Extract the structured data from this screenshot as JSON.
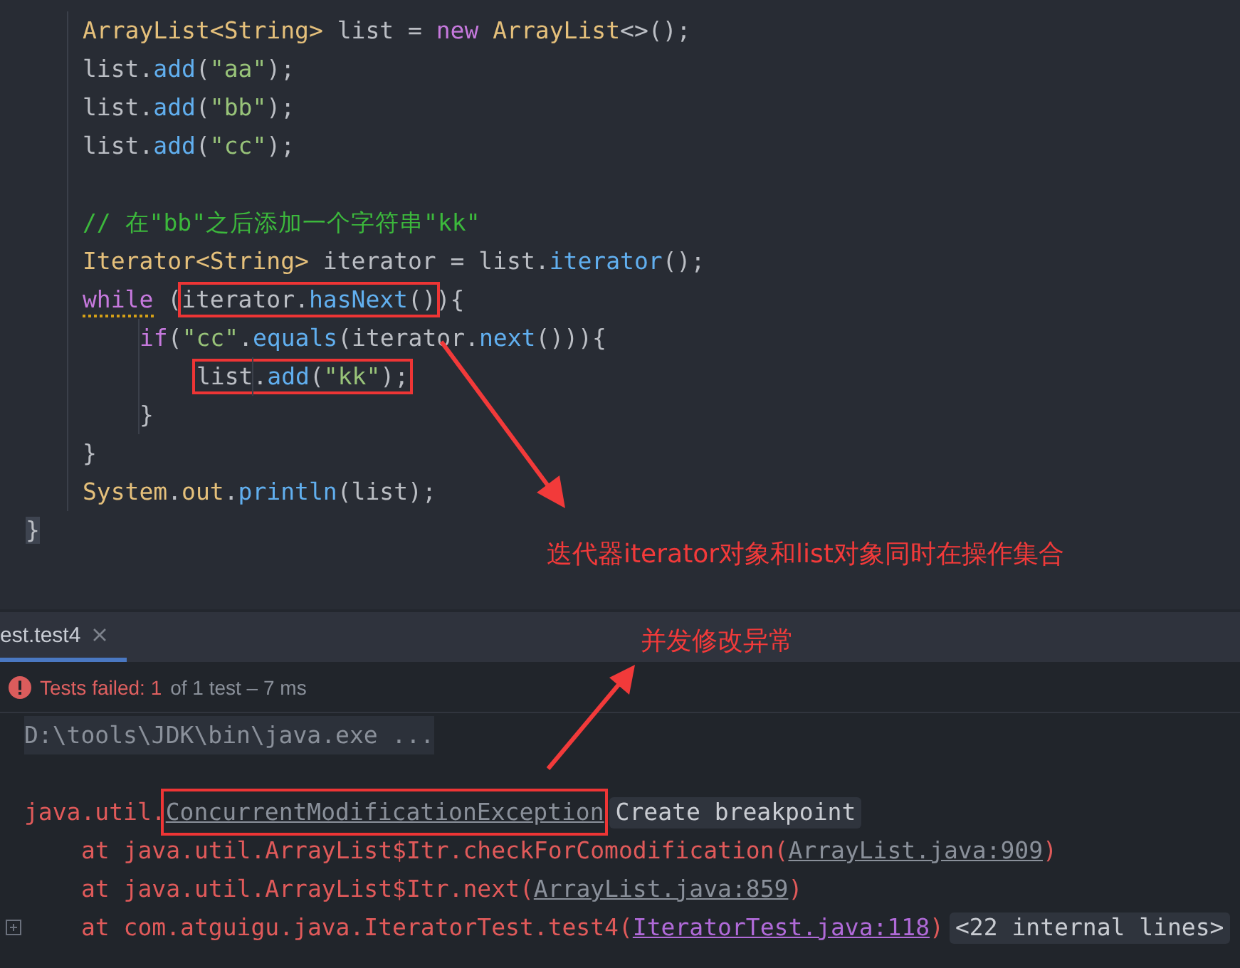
{
  "editor": {
    "lines": [
      {
        "kind": "block",
        "children": [
          {
            "kind": "code",
            "tokens": [
              {
                "kind": "type",
                "text": "ArrayList<String>"
              },
              {
                "kind": "plain",
                "text": " list = "
              },
              {
                "kind": "keyword",
                "text": "new"
              },
              {
                "kind": "type",
                "text": " ArrayList"
              },
              {
                "kind": "plain",
                "text": "<>();"
              }
            ]
          },
          {
            "kind": "code",
            "tokens": [
              {
                "kind": "plain",
                "text": "list."
              },
              {
                "kind": "method",
                "text": "add"
              },
              {
                "kind": "plain",
                "text": "("
              },
              {
                "kind": "string",
                "text": "\"aa\""
              },
              {
                "kind": "plain",
                "text": ");"
              }
            ]
          },
          {
            "kind": "code",
            "tokens": [
              {
                "kind": "plain",
                "text": "list."
              },
              {
                "kind": "method",
                "text": "add"
              },
              {
                "kind": "plain",
                "text": "("
              },
              {
                "kind": "string",
                "text": "\"bb\""
              },
              {
                "kind": "plain",
                "text": ");"
              }
            ]
          },
          {
            "kind": "code",
            "tokens": [
              {
                "kind": "plain",
                "text": "list."
              },
              {
                "kind": "method",
                "text": "add"
              },
              {
                "kind": "plain",
                "text": "("
              },
              {
                "kind": "string",
                "text": "\"cc\""
              },
              {
                "kind": "plain",
                "text": ");"
              }
            ]
          },
          {
            "kind": "blank"
          },
          {
            "kind": "code",
            "tokens": [
              {
                "kind": "comment",
                "text": "// 在\"bb\"之后添加一个字符串\"kk\""
              }
            ]
          },
          {
            "kind": "code",
            "tokens": [
              {
                "kind": "type",
                "text": "Iterator<String>"
              },
              {
                "kind": "plain",
                "text": " iterator = list."
              },
              {
                "kind": "method",
                "text": "iterator"
              },
              {
                "kind": "plain",
                "text": "();"
              }
            ]
          },
          {
            "kind": "code",
            "tokens": [
              {
                "kind": "keyword",
                "text": "while",
                "warning": true
              },
              {
                "kind": "plain",
                "text": " ("
              },
              {
                "kind": "group",
                "boxed": true,
                "tokens": [
                  {
                    "kind": "plain",
                    "text": "iterator."
                  },
                  {
                    "kind": "method",
                    "text": "hasNext"
                  },
                  {
                    "kind": "plain",
                    "text": "()"
                  }
                ]
              },
              {
                "kind": "plain",
                "text": "){"
              }
            ],
            "children": [
              {
                "kind": "code",
                "tokens": [
                  {
                    "kind": "keyword",
                    "text": "if"
                  },
                  {
                    "kind": "plain",
                    "text": "("
                  },
                  {
                    "kind": "string",
                    "text": "\"cc\""
                  },
                  {
                    "kind": "plain",
                    "text": "."
                  },
                  {
                    "kind": "method",
                    "text": "equals"
                  },
                  {
                    "kind": "plain",
                    "text": "(iterator."
                  },
                  {
                    "kind": "method",
                    "text": "next"
                  },
                  {
                    "kind": "plain",
                    "text": "())){"
                  }
                ],
                "children": [
                  {
                    "kind": "code",
                    "tokens": [
                      {
                        "kind": "group",
                        "boxed": true,
                        "tokens": [
                          {
                            "kind": "plain",
                            "text": "list."
                          },
                          {
                            "kind": "method",
                            "text": "add"
                          },
                          {
                            "kind": "plain",
                            "text": "("
                          },
                          {
                            "kind": "string",
                            "text": "\"kk\""
                          },
                          {
                            "kind": "plain",
                            "text": ");"
                          }
                        ]
                      }
                    ]
                  }
                ]
              },
              {
                "kind": "code",
                "tokens": [
                  {
                    "kind": "plain",
                    "text": "}"
                  }
                ]
              }
            ]
          },
          {
            "kind": "code",
            "tokens": [
              {
                "kind": "plain",
                "text": "}"
              }
            ]
          },
          {
            "kind": "code",
            "tokens": [
              {
                "kind": "type",
                "text": "System"
              },
              {
                "kind": "plain",
                "text": "."
              },
              {
                "kind": "field",
                "text": "out"
              },
              {
                "kind": "plain",
                "text": "."
              },
              {
                "kind": "method",
                "text": "println"
              },
              {
                "kind": "plain",
                "text": "(list);"
              }
            ]
          }
        ]
      },
      {
        "kind": "code",
        "tokens": [
          {
            "kind": "plain",
            "text": "}",
            "matched": true
          }
        ]
      }
    ]
  },
  "annotations": [
    {
      "text": "迭代器iterator对象和list对象同时在操作集合"
    },
    {
      "text": "并发修改异常"
    }
  ],
  "run_panel": {
    "tabs": [
      {
        "label": "est.test4",
        "selected": true
      }
    ],
    "status": {
      "kind": "failed",
      "summary": "Tests failed: 1",
      "detail": "of 1 test – 7 ms"
    },
    "console": [
      {
        "kind": "command",
        "segments": [
          {
            "kind": "command",
            "text": "D:\\tools\\JDK\\bin\\java.exe ..."
          }
        ]
      },
      {
        "kind": "blank"
      },
      {
        "kind": "trace",
        "segments": [
          {
            "kind": "error",
            "text": "java.util."
          },
          {
            "kind": "link",
            "text": "ConcurrentModificationException",
            "boxed": true,
            "visited": false
          },
          {
            "kind": "chip",
            "text": "Create breakpoint"
          }
        ],
        "children": [
          {
            "kind": "trace",
            "expandable": false,
            "segments": [
              {
                "kind": "error",
                "text": "at java.util.ArrayList$Itr.checkForComodification("
              },
              {
                "kind": "link",
                "text": "ArrayList.java:909",
                "visited": false
              },
              {
                "kind": "error",
                "text": ")"
              }
            ]
          },
          {
            "kind": "trace",
            "expandable": false,
            "segments": [
              {
                "kind": "error",
                "text": "at java.util.ArrayList$Itr.next("
              },
              {
                "kind": "link",
                "text": "ArrayList.java:859",
                "visited": false
              },
              {
                "kind": "error",
                "text": ")"
              }
            ]
          },
          {
            "kind": "trace",
            "expandable": true,
            "segments": [
              {
                "kind": "error",
                "text": "at com.atguigu.java.IteratorTest.test4("
              },
              {
                "kind": "link",
                "text": "IteratorTest.java:118",
                "visited": true
              },
              {
                "kind": "error",
                "text": ")"
              },
              {
                "kind": "chip",
                "text": "<22 internal lines>"
              }
            ]
          }
        ]
      }
    ]
  }
}
